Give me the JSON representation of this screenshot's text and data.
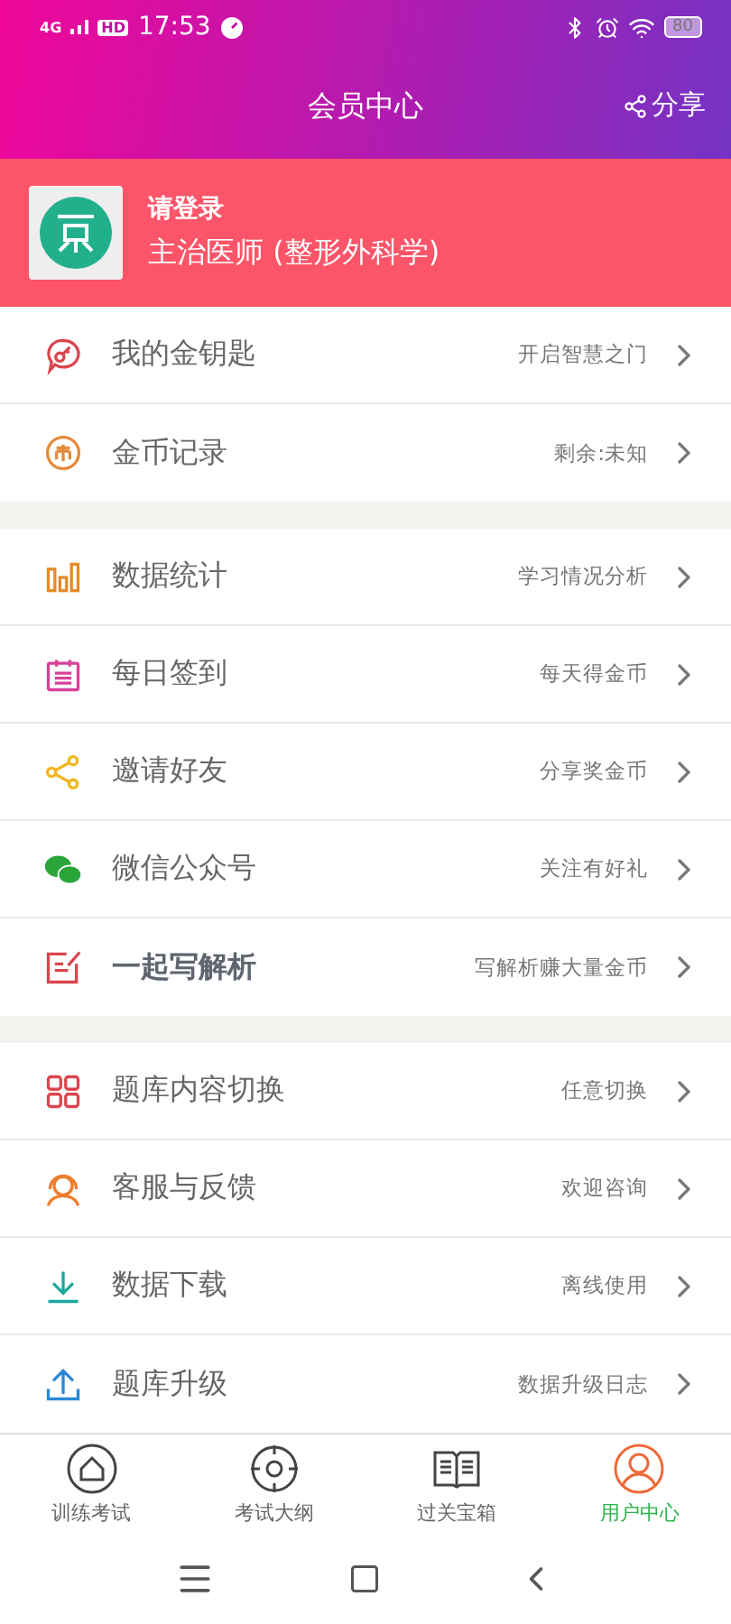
{
  "status_bar": {
    "network": "4G",
    "hd": "HD",
    "time": "17:53",
    "battery": "80"
  },
  "header": {
    "title": "会员中心",
    "share": "分享"
  },
  "profile": {
    "name": "请登录",
    "subtitle": "主治医师 (整形外科学)"
  },
  "sections": [
    {
      "items": [
        {
          "kind": "key",
          "label": "我的金钥匙",
          "hint": "开启智慧之门",
          "bold": false
        },
        {
          "kind": "coin",
          "label": "金币记录",
          "hint": "剩余:未知",
          "bold": false
        }
      ]
    },
    {
      "items": [
        {
          "kind": "chart",
          "label": "数据统计",
          "hint": "学习情况分析",
          "bold": false
        },
        {
          "kind": "calendar",
          "label": "每日签到",
          "hint": "每天得金币",
          "bold": false
        },
        {
          "kind": "share",
          "label": "邀请好友",
          "hint": "分享奖金币",
          "bold": false
        },
        {
          "kind": "chat",
          "label": "微信公众号",
          "hint": "关注有好礼",
          "bold": false
        },
        {
          "kind": "edit",
          "label": "一起写解析",
          "hint": "写解析赚大量金币",
          "bold": true
        }
      ]
    },
    {
      "items": [
        {
          "kind": "grid",
          "label": "题库内容切换",
          "hint": "任意切换",
          "bold": false
        },
        {
          "kind": "support",
          "label": "客服与反馈",
          "hint": "欢迎咨询",
          "bold": false
        },
        {
          "kind": "download",
          "label": "数据下载",
          "hint": "离线使用",
          "bold": false
        },
        {
          "kind": "upload",
          "label": "题库升级",
          "hint": "数据升级日志",
          "bold": false
        }
      ]
    }
  ],
  "tabs": [
    {
      "kind": "home",
      "label": "训练考试",
      "selected": false
    },
    {
      "kind": "target",
      "label": "考试大纲",
      "selected": false
    },
    {
      "kind": "book",
      "label": "过关宝箱",
      "selected": false
    },
    {
      "kind": "user",
      "label": "用户中心",
      "selected": true
    }
  ]
}
